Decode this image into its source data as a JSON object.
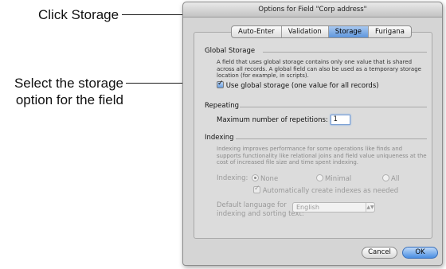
{
  "callouts": {
    "click_storage": "Click Storage",
    "select_option_line1": "Select the storage",
    "select_option_line2": "option for the field"
  },
  "window": {
    "title": "Options for Field \"Corp address\""
  },
  "tabs": [
    {
      "label": "Auto-Enter",
      "active": false
    },
    {
      "label": "Validation",
      "active": false
    },
    {
      "label": "Storage",
      "active": true
    },
    {
      "label": "Furigana",
      "active": false
    }
  ],
  "global_storage": {
    "heading": "Global Storage",
    "description": "A field that uses global storage contains only one value that is shared across all records.  A global field can also be used as a temporary storage location (for example, in scripts).",
    "checkbox_label": "Use global storage (one value for all records)",
    "checked": true
  },
  "repeating": {
    "heading": "Repeating",
    "label": "Maximum number of repetitions:",
    "value": "1"
  },
  "indexing": {
    "heading": "Indexing",
    "description": "Indexing improves performance for some operations like finds and supports functionality like relational joins and field value uniqueness at the cost of increased file size and time spent indexing.",
    "label": "Indexing:",
    "options": [
      "None",
      "Minimal",
      "All"
    ],
    "selected": "None",
    "auto_create_label": "Automatically create indexes as needed",
    "auto_create_checked": true,
    "language_label_line1": "Default language for",
    "language_label_line2": "indexing and sorting text:",
    "language_value": "English"
  },
  "buttons": {
    "cancel": "Cancel",
    "ok": "OK"
  },
  "colors": {
    "accent_blue": "#5f96dd",
    "window_bg": "#d5d5d5"
  }
}
